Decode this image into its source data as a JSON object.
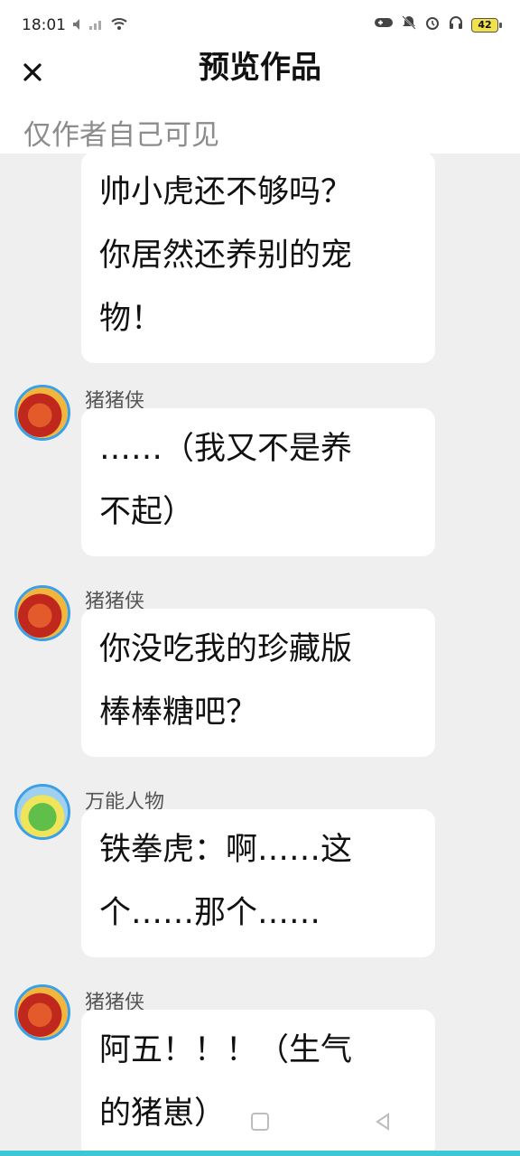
{
  "status_bar": {
    "time": "18:01",
    "left_icons": [
      "mute-icon",
      "signal-icon",
      "wifi-icon"
    ],
    "right_icons": [
      "game-icon",
      "notifications-off-icon",
      "alarm-icon",
      "headphones-icon"
    ],
    "battery": "42"
  },
  "header": {
    "title": "预览作品",
    "visibility_note": "仅作者自己可见"
  },
  "messages": [
    {
      "user": "",
      "avatar": "",
      "text_lines": [
        "帅小虎还不够吗？",
        "你居然还养别的宠",
        "物！"
      ]
    },
    {
      "user": "猪猪侠",
      "avatar": "red",
      "text_lines": [
        "……（我又不是养",
        "不起）"
      ]
    },
    {
      "user": "猪猪侠",
      "avatar": "red",
      "text_lines": [
        "你没吃我的珍藏版",
        "棒棒糖吧？"
      ]
    },
    {
      "user": "万能人物",
      "avatar": "green",
      "text_lines": [
        "铁拳虎：啊……这",
        "个……那个……"
      ]
    },
    {
      "user": "猪猪侠",
      "avatar": "red",
      "text_lines": [
        "阿五！！！（生气",
        "的猪崽）"
      ]
    }
  ],
  "colors": {
    "avatar_border": "#3aa0e8",
    "background": "#efefef",
    "bubble": "#ffffff",
    "accent_bottom": "#3cc6d6"
  }
}
